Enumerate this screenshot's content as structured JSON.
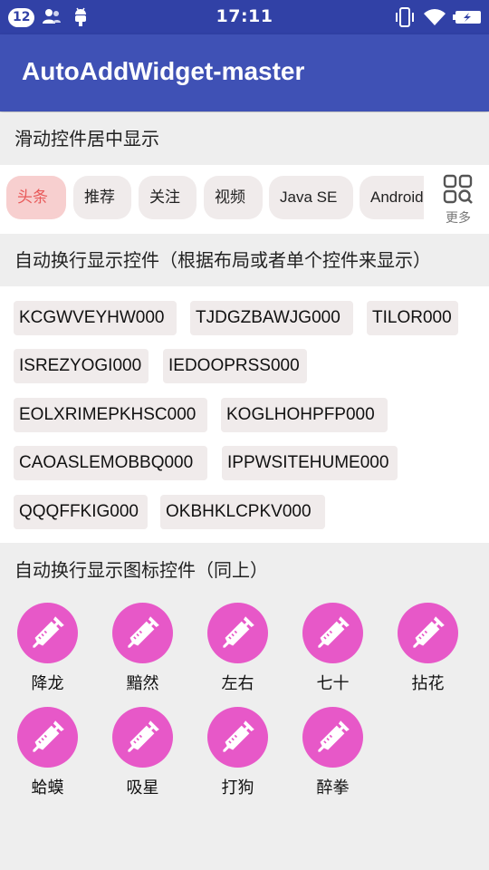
{
  "status_bar": {
    "notification_count": "12",
    "time": "17:11",
    "icons": [
      "contacts-sync-icon",
      "android-debug-icon",
      "vibrate-icon",
      "wifi-icon",
      "battery-charging-icon"
    ]
  },
  "app_bar": {
    "title": "AutoAddWidget-master"
  },
  "sections": {
    "scroll_center": {
      "title": "滑动控件居中显示"
    },
    "auto_wrap": {
      "title": "自动换行显示控件（根据布局或者单个控件来显示）"
    },
    "auto_wrap_icons": {
      "title": "自动换行显示图标控件（同上）"
    }
  },
  "tabs": {
    "items": [
      "头条",
      "推荐",
      "关注",
      "视频",
      "Java SE",
      "Android"
    ],
    "selected": "头条",
    "more_label": "更多",
    "accent_color": "#e85a5a"
  },
  "tags": [
    "KCGWVEYHW000",
    "TJDGZBAWJG000",
    "TILOR000",
    "ISREZYOGI000",
    "IEDOOPRSS000",
    "EOLXRIMEPKHSC000",
    "KOGLHOHPFP000",
    "CAOASLEMOBBQ000",
    "IPPWSITEHUME000",
    "QQQFFKIG000",
    "OKBHKLCPKV000"
  ],
  "icon_grid": {
    "icon": "syringe-icon",
    "color": "#e758c8",
    "items": [
      "降龙",
      "黯然",
      "左右",
      "七十",
      "拈花",
      "蛤蟆",
      "吸星",
      "打狗",
      "醉拳"
    ]
  }
}
